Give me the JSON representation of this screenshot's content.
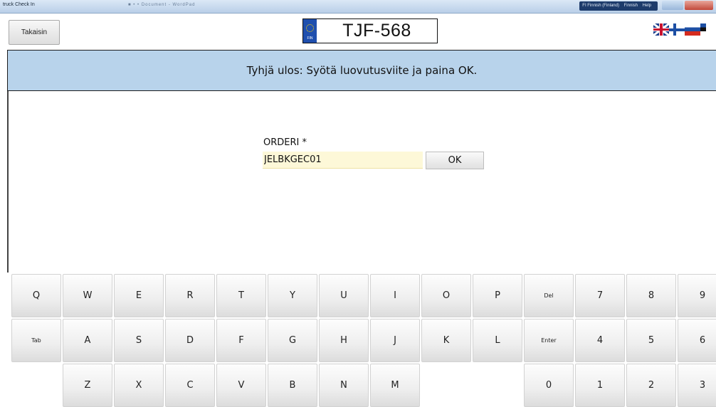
{
  "window": {
    "title": "truck Check In",
    "center_text": "■ • • Document - WordPad",
    "lang_items": [
      "FI Finnish (Finland)",
      "Finnish",
      "Help"
    ]
  },
  "header": {
    "back_label": "Takaisin",
    "plate": {
      "country": "FIN",
      "number": "TJF-568"
    },
    "flags": [
      "uk-flag-icon",
      "finland-flag-icon",
      "russia-flag-icon",
      "estonia-flag-icon"
    ]
  },
  "banner": {
    "message": "Tyhjä ulos: Syötä luovutusviite ja paina OK."
  },
  "form": {
    "label": "ORDERI *",
    "value": "JELBKGEC01",
    "ok_label": "OK"
  },
  "keyboard": {
    "rows": [
      [
        "Q",
        "W",
        "E",
        "R",
        "T",
        "Y",
        "U",
        "I",
        "O",
        "P",
        "Del",
        "7",
        "8",
        "9"
      ],
      [
        "Tab",
        "A",
        "S",
        "D",
        "F",
        "G",
        "H",
        "J",
        "K",
        "L",
        "Enter",
        "4",
        "5",
        "6"
      ],
      [
        "",
        "Z",
        "X",
        "C",
        "V",
        "B",
        "N",
        "M",
        "",
        "",
        "0",
        "1",
        "2",
        "3"
      ]
    ]
  },
  "colors": {
    "banner_bg": "#b8d3eb",
    "input_bg": "#fdf8d8",
    "plate_eu_blue": "#1f4fae"
  }
}
